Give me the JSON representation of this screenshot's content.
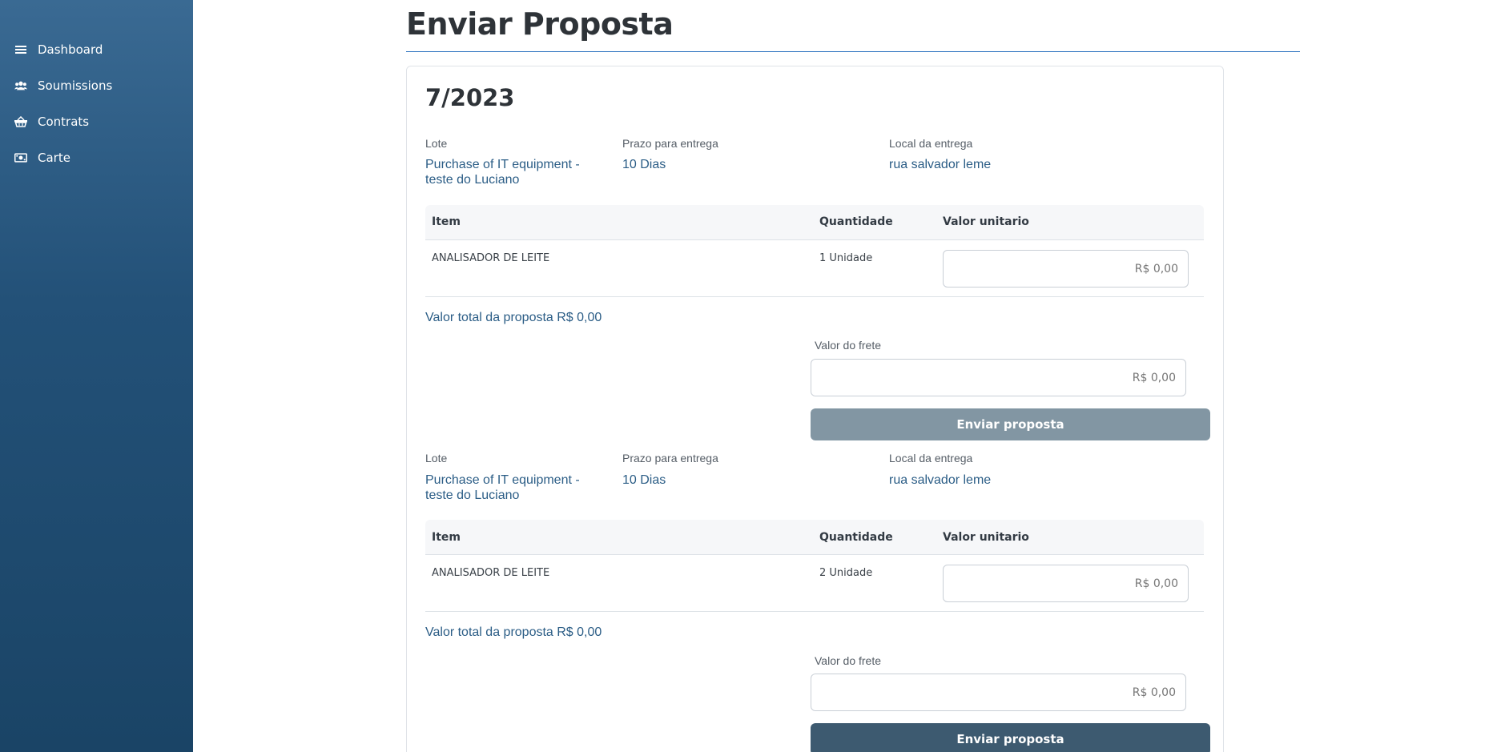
{
  "sidebar": {
    "items": [
      {
        "label": "Dashboard",
        "icon": "menu-icon"
      },
      {
        "label": "Soumissions",
        "icon": "users-icon"
      },
      {
        "label": "Contrats",
        "icon": "basket-icon"
      },
      {
        "label": "Carte",
        "icon": "money-icon"
      }
    ]
  },
  "page": {
    "title": "Enviar Proposta"
  },
  "card": {
    "title": "7/2023"
  },
  "labels": {
    "lote": "Lote",
    "prazo": "Prazo para entrega",
    "local": "Local da entrega",
    "item": "Item",
    "quantidade": "Quantidade",
    "valor_unitario": "Valor unitario",
    "valor_total": "Valor total da proposta R$  0,00",
    "valor_frete": "Valor do frete",
    "enviar": "Enviar proposta"
  },
  "lots": [
    {
      "lote_line1": "Purchase of IT equipment -",
      "lote_line2": "teste do Luciano",
      "prazo": "10 Dias",
      "local": "rua salvador leme",
      "item_name": "ANALISADOR DE LEITE",
      "quantidade": "1 Unidade",
      "valor_unitario_placeholder": "R$ 0,00",
      "frete_placeholder": "R$ 0,00",
      "button_state": "disabled"
    },
    {
      "lote_line1": "Purchase of IT equipment -",
      "lote_line2": "teste do Luciano",
      "prazo": "10 Dias",
      "local": "rua salvador leme",
      "item_name": "ANALISADOR DE LEITE",
      "quantidade": "2 Unidade",
      "valor_unitario_placeholder": "R$ 0,00",
      "frete_placeholder": "R$ 0,00",
      "button_state": "enabled"
    }
  ],
  "colors": {
    "sidebar_top": "#3a6a93",
    "sidebar_bottom": "#1a4466",
    "accent_text": "#2b5d86",
    "button_disabled": "#8296a3",
    "button_enabled": "#3d5a70",
    "title_rule": "#2f74c0"
  }
}
